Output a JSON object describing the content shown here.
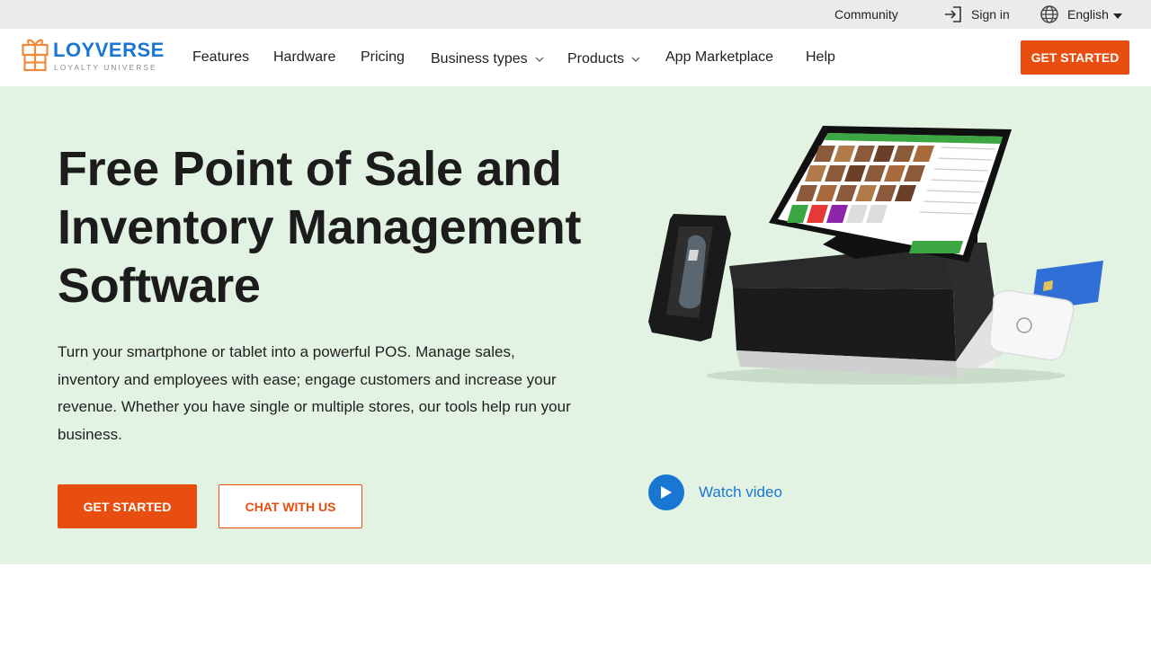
{
  "topbar": {
    "community": "Community",
    "sign_in": "Sign in",
    "language": "English"
  },
  "header": {
    "logo_name": "LOYVERSE",
    "logo_tagline": "LOYALTY UNIVERSE",
    "nav": {
      "features": "Features",
      "hardware": "Hardware",
      "pricing": "Pricing",
      "business_types": "Business types",
      "products": "Products",
      "app_marketplace": "App Marketplace",
      "help": "Help"
    },
    "cta": "GET STARTED"
  },
  "hero": {
    "title_lines": [
      "Free Point of Sale and",
      "Inventory Management",
      "Software"
    ],
    "description": "Turn your smartphone or tablet into a powerful POS. Manage sales, inventory and employees with ease; engage customers and increase your revenue. Whether you have single or multiple stores, our tools help run your business.",
    "primary_button": "GET STARTED",
    "secondary_button": "CHAT WITH US",
    "watch_video": "Watch video"
  },
  "colors": {
    "brand_orange": "#e84e0f",
    "brand_blue": "#1976d2",
    "hero_bg": "#e3f3e3",
    "topbar_bg": "#ebebeb"
  },
  "icons": [
    "login-icon",
    "globe-icon",
    "caret-down-icon",
    "chevron-down-icon",
    "play-icon"
  ]
}
